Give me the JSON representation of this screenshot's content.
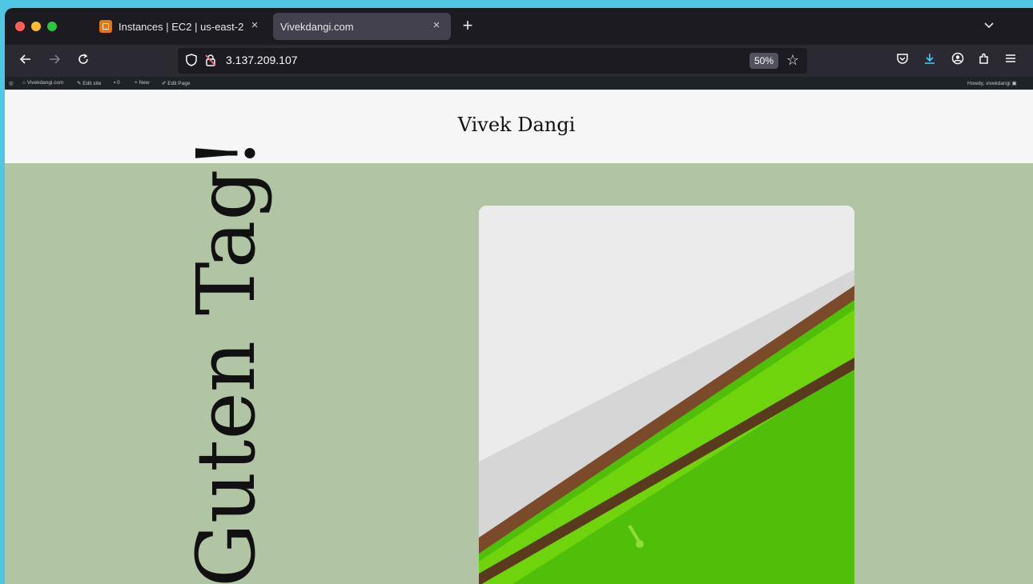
{
  "browser": {
    "tabs": [
      {
        "label": "Instances | EC2 | us-east-2",
        "active": false,
        "icon": "aws-ec2-icon"
      },
      {
        "label": "Vivekdangi.com",
        "active": true
      }
    ],
    "new_tab_label": "+",
    "close_glyph": "×",
    "url": "3.137.209.107",
    "zoom": "50%"
  },
  "wp_admin_bar": {
    "site_name": "Vivekdangi.com",
    "edit_site": "Edit site",
    "comments_count": "0",
    "new_label": "New",
    "edit_page": "Edit Page",
    "howdy": "Howdy, vivekdangi"
  },
  "site": {
    "title": "Vivek Dangi",
    "hero_heading": "Guten Tag!"
  },
  "colors": {
    "hero_background": "#b1c5a4",
    "header_background": "#f6f6f6",
    "browser_chrome": "#1c1b22"
  }
}
